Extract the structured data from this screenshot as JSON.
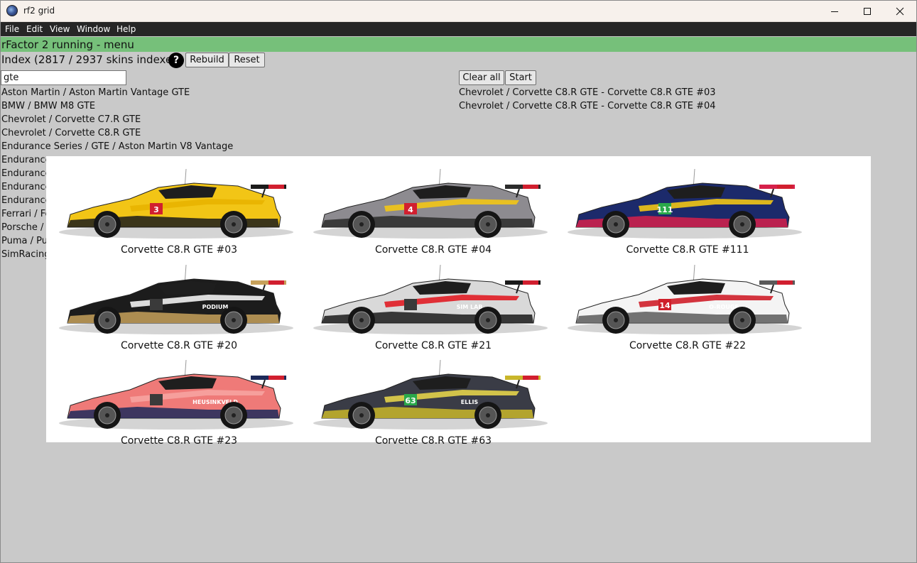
{
  "window": {
    "title": "rf2 grid",
    "controls": [
      "minimize-icon",
      "maximize-icon",
      "close-icon"
    ]
  },
  "menu": [
    "File",
    "Edit",
    "View",
    "Window",
    "Help"
  ],
  "status": {
    "text": "rFactor 2 running - menu",
    "color": "#76c07a"
  },
  "index": {
    "text": "Index (2817 / 2937 skins indexed)",
    "help_label": "?",
    "rebuild_label": "Rebuild",
    "reset_label": "Reset"
  },
  "search": {
    "value": "gte"
  },
  "actions": {
    "clear_label": "Clear all",
    "start_label": "Start"
  },
  "car_list": [
    "Aston Martin / Aston Martin Vantage GTE",
    "BMW / BMW M8 GTE",
    "Chevrolet / Corvette C7.R GTE",
    "Chevrolet / Corvette C8.R GTE",
    "Endurance Series / GTE / Aston Martin V8 Vantage",
    "Endurance",
    "Endurance",
    "Endurance",
    "Endurance",
    "Ferrari / Fe",
    "Porsche / I",
    "Puma / Pu",
    "SimRacing"
  ],
  "selected": [
    "Chevrolet / Corvette C8.R GTE - Corvette C8.R GTE #03",
    "Chevrolet / Corvette C8.R GTE - Corvette C8.R GTE #04"
  ],
  "skins": [
    {
      "label": "Corvette C8.R GTE #03",
      "number": "3",
      "sponsor": "",
      "colors": {
        "body": "#f2c516",
        "accent": "#1b1b1b",
        "stripe": "#e8b300",
        "plate": "#d11f2f"
      }
    },
    {
      "label": "Corvette C8.R GTE #04",
      "number": "4",
      "sponsor": "",
      "colors": {
        "body": "#8d8b90",
        "accent": "#2b2b2b",
        "stripe": "#f2c516",
        "plate": "#d11f2f"
      }
    },
    {
      "label": "Corvette C8.R GTE #111",
      "number": "111",
      "sponsor": "",
      "colors": {
        "body": "#1c2a6b",
        "accent": "#d6204a",
        "stripe": "#f2c516",
        "plate": "#2aa84a"
      }
    },
    {
      "label": "Corvette C8.R GTE #20",
      "number": "",
      "sponsor": "PODIUM",
      "colors": {
        "body": "#1c1c1c",
        "accent": "#c7a15a",
        "stripe": "#f2f2f2",
        "plate": "#3a3a3a"
      }
    },
    {
      "label": "Corvette C8.R GTE #21",
      "number": "",
      "sponsor": "SIM LAB",
      "colors": {
        "body": "#d9d9d9",
        "accent": "#1a1a1a",
        "stripe": "#e01c24",
        "plate": "#3a3a3a"
      }
    },
    {
      "label": "Corvette C8.R GTE #22",
      "number": "14",
      "sponsor": "O-ROUGE",
      "colors": {
        "body": "#f4f4f4",
        "accent": "#5a5a5a",
        "stripe": "#cf1f2a",
        "plate": "#cf1f2a"
      }
    },
    {
      "label": "Corvette C8.R GTE #23",
      "number": "",
      "sponsor": "HEUSINKVELD",
      "colors": {
        "body": "#ef7a78",
        "accent": "#1d2a5a",
        "stripe": "#f6a3a0",
        "plate": "#3a3a3a"
      }
    },
    {
      "label": "Corvette C8.R GTE #63",
      "number": "63",
      "sponsor": "ELLIS",
      "colors": {
        "body": "#3a3c46",
        "accent": "#c9b62a",
        "stripe": "#e3d24a",
        "plate": "#2aa84a"
      }
    }
  ]
}
